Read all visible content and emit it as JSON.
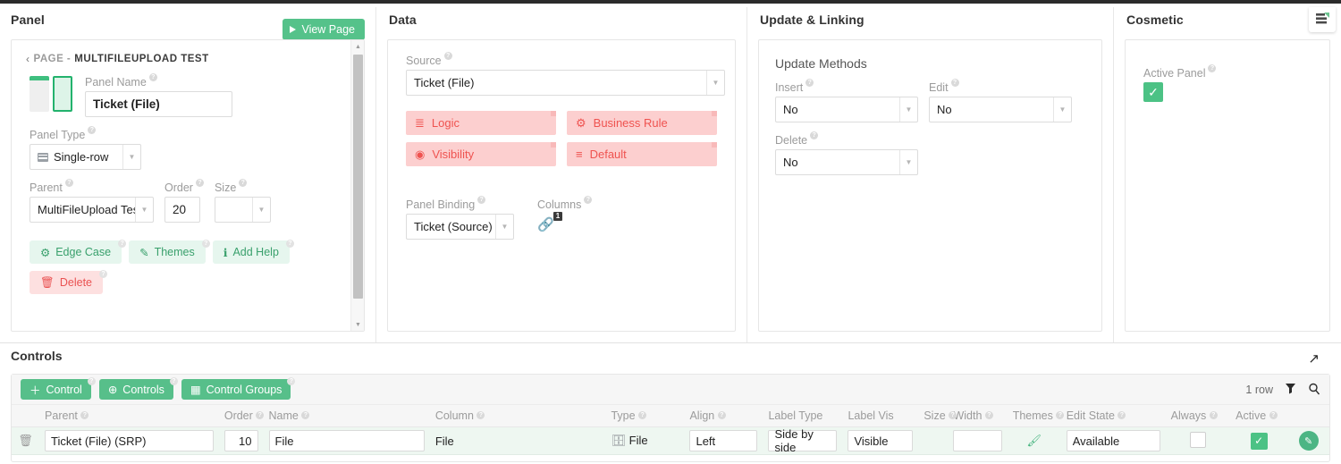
{
  "sections": {
    "panel": "Panel",
    "data": "Data",
    "update_linking": "Update & Linking",
    "cosmetic": "Cosmetic",
    "controls": "Controls"
  },
  "panel": {
    "view_page_button": "View Page",
    "breadcrumb_chevron": "‹",
    "breadcrumb_page": "PAGE -",
    "breadcrumb_name": "MULTIFILEUPLOAD TEST",
    "panel_name_label": "Panel Name",
    "panel_name_value": "Ticket (File)",
    "panel_type_label": "Panel Type",
    "panel_type_value": "Single-row",
    "parent_label": "Parent",
    "parent_value": "MultiFileUpload Test",
    "order_label": "Order",
    "order_value": "20",
    "size_label": "Size",
    "size_value": "",
    "buttons": [
      {
        "label": "Edge Case",
        "icon": "gear-icon",
        "glyph": "⚙",
        "style": "green"
      },
      {
        "label": "Themes",
        "icon": "brush-icon",
        "glyph": "✎",
        "style": "green"
      },
      {
        "label": "Add Help",
        "icon": "info-icon",
        "glyph": "ℹ",
        "style": "green"
      },
      {
        "label": "Delete",
        "icon": "trash-icon",
        "glyph": "🗑",
        "style": "red"
      }
    ]
  },
  "data": {
    "source_label": "Source",
    "source_value": "Ticket (File)",
    "pills": [
      {
        "label": "Logic",
        "icon": "database-icon",
        "glyph": "≣"
      },
      {
        "label": "Business Rule",
        "icon": "gears-icon",
        "glyph": "⚙"
      },
      {
        "label": "Visibility",
        "icon": "eye-icon",
        "glyph": "◉"
      },
      {
        "label": "Default",
        "icon": "sliders-icon",
        "glyph": "≡"
      }
    ],
    "panel_binding_label": "Panel Binding",
    "panel_binding_value": "Ticket (Source)",
    "columns_label": "Columns",
    "columns_count": "1"
  },
  "update": {
    "group_title": "Update Methods",
    "insert_label": "Insert",
    "insert_value": "No",
    "edit_label": "Edit",
    "edit_value": "No",
    "delete_label": "Delete",
    "delete_value": "No"
  },
  "cosmetic": {
    "active_panel_label": "Active Panel",
    "active_panel_checked": "✓"
  },
  "controls": {
    "expand_icon": "↗",
    "toolbar_buttons": [
      {
        "label": "Control",
        "icon": "plus-icon",
        "glyph": "＋"
      },
      {
        "label": "Controls",
        "icon": "circle-plus-icon",
        "glyph": "⊕"
      },
      {
        "label": "Control Groups",
        "icon": "columns-icon",
        "glyph": "▦"
      }
    ],
    "row_count": "1 row",
    "filter_icon": "▼",
    "search_icon": "⌕",
    "columns": [
      {
        "label": "",
        "help": false
      },
      {
        "label": "Parent",
        "help": true
      },
      {
        "label": "Order",
        "help": true
      },
      {
        "label": "Name",
        "help": true
      },
      {
        "label": "Column",
        "help": true
      },
      {
        "label": "Type",
        "help": true
      },
      {
        "label": "Align",
        "help": true
      },
      {
        "label": "Label Type",
        "help": false
      },
      {
        "label": "Label Vis",
        "help": false
      },
      {
        "label": "Size",
        "help": true
      },
      {
        "label": "Width",
        "help": true
      },
      {
        "label": "Themes",
        "help": true
      },
      {
        "label": "Edit State",
        "help": true
      },
      {
        "label": "Always",
        "help": true
      },
      {
        "label": "Active",
        "help": true
      },
      {
        "label": "",
        "help": false
      }
    ],
    "rows": [
      {
        "delete_icon": "🗑",
        "parent": "Ticket (File) (SRP)",
        "order": "10",
        "name": "File",
        "column": "File",
        "type": "File",
        "type_icon": "file-type-icon",
        "align": "Left",
        "label_type": "Side by side",
        "label_vis": "Visible",
        "size": "",
        "width": "",
        "themes_icon": "brush-icon",
        "edit_state": "Available",
        "always_checked": false,
        "active_checked": true,
        "active_check_glyph": "✓",
        "edit_glyph": "✎"
      }
    ]
  },
  "colors": {
    "green": "#4cb584",
    "green_light": "#e6f6ee",
    "red": "#ef5350",
    "red_light": "#fccfcf",
    "row_bg": "#eef7f1"
  }
}
